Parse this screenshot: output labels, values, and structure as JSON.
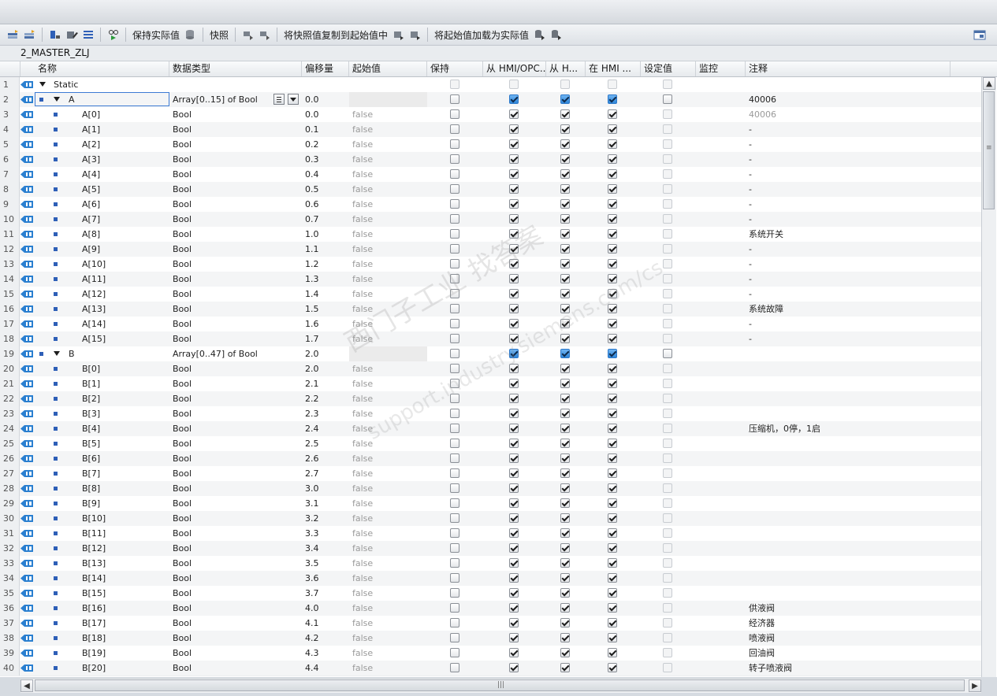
{
  "toolbar": {
    "keep_actual": "保持实际值",
    "snapshot": "快照",
    "copy_snapshot": "将快照值复制到起始值中",
    "load_start": "将起始值加载为实际值"
  },
  "block_title": "2_MASTER_ZLJ",
  "columns": [
    "名称",
    "数据类型",
    "偏移量",
    "起始值",
    "保持",
    "从 HMI/OPC...",
    "从 H...",
    "在 HMI ...",
    "设定值",
    "监控",
    "注释"
  ],
  "dropdown_icon": "list-icon",
  "rows": [
    {
      "n": "1",
      "level": 0,
      "name": "Static",
      "type": "",
      "offset": "",
      "start": "",
      "retain": "dis",
      "c1": "dis",
      "c2": "dis",
      "c3": "dis",
      "setp": "dis",
      "comment": ""
    },
    {
      "n": "2",
      "level": 1,
      "name": "A",
      "type": "Array[0..15] of Bool",
      "offset": "0.0",
      "start": "",
      "retain": "on",
      "c1": "blue",
      "c2": "blue",
      "c3": "blue",
      "setp": "on",
      "comment": "40006",
      "selected": true
    },
    {
      "n": "3",
      "level": 2,
      "name": "A[0]",
      "type": "Bool",
      "offset": "0.0",
      "start": "false",
      "retain": "on",
      "c1": "chk",
      "c2": "chk",
      "c3": "chk",
      "setp": "dis",
      "comment": "40006",
      "comment_dim": true
    },
    {
      "n": "4",
      "level": 2,
      "name": "A[1]",
      "type": "Bool",
      "offset": "0.1",
      "start": "false",
      "retain": "on",
      "c1": "chk",
      "c2": "chk",
      "c3": "chk",
      "setp": "dis",
      "comment": "-"
    },
    {
      "n": "5",
      "level": 2,
      "name": "A[2]",
      "type": "Bool",
      "offset": "0.2",
      "start": "false",
      "retain": "on",
      "c1": "chk",
      "c2": "chk",
      "c3": "chk",
      "setp": "dis",
      "comment": "-"
    },
    {
      "n": "6",
      "level": 2,
      "name": "A[3]",
      "type": "Bool",
      "offset": "0.3",
      "start": "false",
      "retain": "on",
      "c1": "chk",
      "c2": "chk",
      "c3": "chk",
      "setp": "dis",
      "comment": "-"
    },
    {
      "n": "7",
      "level": 2,
      "name": "A[4]",
      "type": "Bool",
      "offset": "0.4",
      "start": "false",
      "retain": "on",
      "c1": "chk",
      "c2": "chk",
      "c3": "chk",
      "setp": "dis",
      "comment": "-"
    },
    {
      "n": "8",
      "level": 2,
      "name": "A[5]",
      "type": "Bool",
      "offset": "0.5",
      "start": "false",
      "retain": "on",
      "c1": "chk",
      "c2": "chk",
      "c3": "chk",
      "setp": "dis",
      "comment": "-"
    },
    {
      "n": "9",
      "level": 2,
      "name": "A[6]",
      "type": "Bool",
      "offset": "0.6",
      "start": "false",
      "retain": "on",
      "c1": "chk",
      "c2": "chk",
      "c3": "chk",
      "setp": "dis",
      "comment": "-"
    },
    {
      "n": "10",
      "level": 2,
      "name": "A[7]",
      "type": "Bool",
      "offset": "0.7",
      "start": "false",
      "retain": "on",
      "c1": "chk",
      "c2": "chk",
      "c3": "chk",
      "setp": "dis",
      "comment": "-"
    },
    {
      "n": "11",
      "level": 2,
      "name": "A[8]",
      "type": "Bool",
      "offset": "1.0",
      "start": "false",
      "retain": "on",
      "c1": "chk",
      "c2": "chk",
      "c3": "chk",
      "setp": "dis",
      "comment": "系统开关"
    },
    {
      "n": "12",
      "level": 2,
      "name": "A[9]",
      "type": "Bool",
      "offset": "1.1",
      "start": "false",
      "retain": "on",
      "c1": "chk",
      "c2": "chk",
      "c3": "chk",
      "setp": "dis",
      "comment": "-"
    },
    {
      "n": "13",
      "level": 2,
      "name": "A[10]",
      "type": "Bool",
      "offset": "1.2",
      "start": "false",
      "retain": "on",
      "c1": "chk",
      "c2": "chk",
      "c3": "chk",
      "setp": "dis",
      "comment": "-"
    },
    {
      "n": "14",
      "level": 2,
      "name": "A[11]",
      "type": "Bool",
      "offset": "1.3",
      "start": "false",
      "retain": "on",
      "c1": "chk",
      "c2": "chk",
      "c3": "chk",
      "setp": "dis",
      "comment": "-"
    },
    {
      "n": "15",
      "level": 2,
      "name": "A[12]",
      "type": "Bool",
      "offset": "1.4",
      "start": "false",
      "retain": "on",
      "c1": "chk",
      "c2": "chk",
      "c3": "chk",
      "setp": "dis",
      "comment": "-"
    },
    {
      "n": "16",
      "level": 2,
      "name": "A[13]",
      "type": "Bool",
      "offset": "1.5",
      "start": "false",
      "retain": "on",
      "c1": "chk",
      "c2": "chk",
      "c3": "chk",
      "setp": "dis",
      "comment": "系统故障"
    },
    {
      "n": "17",
      "level": 2,
      "name": "A[14]",
      "type": "Bool",
      "offset": "1.6",
      "start": "false",
      "retain": "on",
      "c1": "chk",
      "c2": "chk",
      "c3": "chk",
      "setp": "dis",
      "comment": "-"
    },
    {
      "n": "18",
      "level": 2,
      "name": "A[15]",
      "type": "Bool",
      "offset": "1.7",
      "start": "false",
      "retain": "on",
      "c1": "chk",
      "c2": "chk",
      "c3": "chk",
      "setp": "dis",
      "comment": "-"
    },
    {
      "n": "19",
      "level": 1,
      "name": "B",
      "type": "Array[0..47] of Bool",
      "offset": "2.0",
      "start": "",
      "retain": "on",
      "c1": "blue",
      "c2": "blue",
      "c3": "blue",
      "setp": "on",
      "comment": ""
    },
    {
      "n": "20",
      "level": 2,
      "name": "B[0]",
      "type": "Bool",
      "offset": "2.0",
      "start": "false",
      "retain": "on",
      "c1": "chk",
      "c2": "chk",
      "c3": "chk",
      "setp": "dis",
      "comment": ""
    },
    {
      "n": "21",
      "level": 2,
      "name": "B[1]",
      "type": "Bool",
      "offset": "2.1",
      "start": "false",
      "retain": "on",
      "c1": "chk",
      "c2": "chk",
      "c3": "chk",
      "setp": "dis",
      "comment": ""
    },
    {
      "n": "22",
      "level": 2,
      "name": "B[2]",
      "type": "Bool",
      "offset": "2.2",
      "start": "false",
      "retain": "on",
      "c1": "chk",
      "c2": "chk",
      "c3": "chk",
      "setp": "dis",
      "comment": ""
    },
    {
      "n": "23",
      "level": 2,
      "name": "B[3]",
      "type": "Bool",
      "offset": "2.3",
      "start": "false",
      "retain": "on",
      "c1": "chk",
      "c2": "chk",
      "c3": "chk",
      "setp": "dis",
      "comment": ""
    },
    {
      "n": "24",
      "level": 2,
      "name": "B[4]",
      "type": "Bool",
      "offset": "2.4",
      "start": "false",
      "retain": "on",
      "c1": "chk",
      "c2": "chk",
      "c3": "chk",
      "setp": "dis",
      "comment": "压缩机，0停，1启"
    },
    {
      "n": "25",
      "level": 2,
      "name": "B[5]",
      "type": "Bool",
      "offset": "2.5",
      "start": "false",
      "retain": "on",
      "c1": "chk",
      "c2": "chk",
      "c3": "chk",
      "setp": "dis",
      "comment": ""
    },
    {
      "n": "26",
      "level": 2,
      "name": "B[6]",
      "type": "Bool",
      "offset": "2.6",
      "start": "false",
      "retain": "on",
      "c1": "chk",
      "c2": "chk",
      "c3": "chk",
      "setp": "dis",
      "comment": ""
    },
    {
      "n": "27",
      "level": 2,
      "name": "B[7]",
      "type": "Bool",
      "offset": "2.7",
      "start": "false",
      "retain": "on",
      "c1": "chk",
      "c2": "chk",
      "c3": "chk",
      "setp": "dis",
      "comment": ""
    },
    {
      "n": "28",
      "level": 2,
      "name": "B[8]",
      "type": "Bool",
      "offset": "3.0",
      "start": "false",
      "retain": "on",
      "c1": "chk",
      "c2": "chk",
      "c3": "chk",
      "setp": "dis",
      "comment": ""
    },
    {
      "n": "29",
      "level": 2,
      "name": "B[9]",
      "type": "Bool",
      "offset": "3.1",
      "start": "false",
      "retain": "on",
      "c1": "chk",
      "c2": "chk",
      "c3": "chk",
      "setp": "dis",
      "comment": ""
    },
    {
      "n": "30",
      "level": 2,
      "name": "B[10]",
      "type": "Bool",
      "offset": "3.2",
      "start": "false",
      "retain": "on",
      "c1": "chk",
      "c2": "chk",
      "c3": "chk",
      "setp": "dis",
      "comment": ""
    },
    {
      "n": "31",
      "level": 2,
      "name": "B[11]",
      "type": "Bool",
      "offset": "3.3",
      "start": "false",
      "retain": "on",
      "c1": "chk",
      "c2": "chk",
      "c3": "chk",
      "setp": "dis",
      "comment": ""
    },
    {
      "n": "32",
      "level": 2,
      "name": "B[12]",
      "type": "Bool",
      "offset": "3.4",
      "start": "false",
      "retain": "on",
      "c1": "chk",
      "c2": "chk",
      "c3": "chk",
      "setp": "dis",
      "comment": ""
    },
    {
      "n": "33",
      "level": 2,
      "name": "B[13]",
      "type": "Bool",
      "offset": "3.5",
      "start": "false",
      "retain": "on",
      "c1": "chk",
      "c2": "chk",
      "c3": "chk",
      "setp": "dis",
      "comment": ""
    },
    {
      "n": "34",
      "level": 2,
      "name": "B[14]",
      "type": "Bool",
      "offset": "3.6",
      "start": "false",
      "retain": "on",
      "c1": "chk",
      "c2": "chk",
      "c3": "chk",
      "setp": "dis",
      "comment": ""
    },
    {
      "n": "35",
      "level": 2,
      "name": "B[15]",
      "type": "Bool",
      "offset": "3.7",
      "start": "false",
      "retain": "on",
      "c1": "chk",
      "c2": "chk",
      "c3": "chk",
      "setp": "dis",
      "comment": ""
    },
    {
      "n": "36",
      "level": 2,
      "name": "B[16]",
      "type": "Bool",
      "offset": "4.0",
      "start": "false",
      "retain": "on",
      "c1": "chk",
      "c2": "chk",
      "c3": "chk",
      "setp": "dis",
      "comment": "供液阀"
    },
    {
      "n": "37",
      "level": 2,
      "name": "B[17]",
      "type": "Bool",
      "offset": "4.1",
      "start": "false",
      "retain": "on",
      "c1": "chk",
      "c2": "chk",
      "c3": "chk",
      "setp": "dis",
      "comment": "经济器"
    },
    {
      "n": "38",
      "level": 2,
      "name": "B[18]",
      "type": "Bool",
      "offset": "4.2",
      "start": "false",
      "retain": "on",
      "c1": "chk",
      "c2": "chk",
      "c3": "chk",
      "setp": "dis",
      "comment": "喷液阀"
    },
    {
      "n": "39",
      "level": 2,
      "name": "B[19]",
      "type": "Bool",
      "offset": "4.3",
      "start": "false",
      "retain": "on",
      "c1": "chk",
      "c2": "chk",
      "c3": "chk",
      "setp": "dis",
      "comment": "回油阀"
    },
    {
      "n": "40",
      "level": 2,
      "name": "B[20]",
      "type": "Bool",
      "offset": "4.4",
      "start": "false",
      "retain": "on",
      "c1": "chk",
      "c2": "chk",
      "c3": "chk",
      "setp": "dis",
      "comment": "转子喷液阀"
    }
  ],
  "watermark": {
    "line1": "西门子工业 找答案",
    "line2": "support.industry.siemens.com/cs"
  }
}
